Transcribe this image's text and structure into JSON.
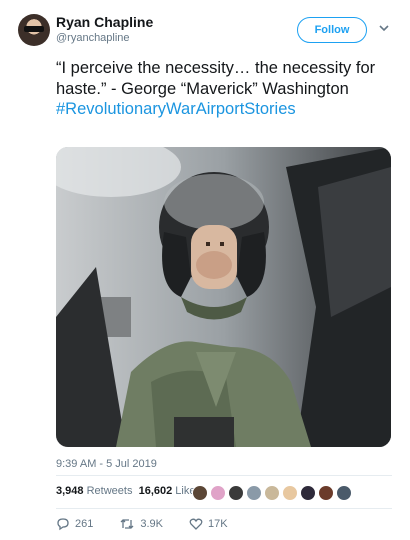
{
  "author": {
    "display_name": "Ryan Chapline",
    "handle": "@ryanchapline"
  },
  "follow_label": "Follow",
  "tweet": {
    "text": "“I perceive the necessity… the necessity for haste.”  - George “Maverick” Washington",
    "hashtag": "#RevolutionaryWarAirportStories"
  },
  "timestamp": "9:39 AM - 5 Jul 2019",
  "stats": {
    "retweets_count": "3,948",
    "retweets_label": "Retweets",
    "likes_count": "16,602",
    "likes_label": "Likes"
  },
  "likers": [
    "#5b4636",
    "#e0a3c8",
    "#3a3a3a",
    "#8a9aa8",
    "#c9b89a",
    "#e8c8a0",
    "#2e2a3a",
    "#6b3b2a",
    "#4a5a6a"
  ],
  "actions": {
    "replies": "261",
    "retweets": "3.9K",
    "likes": "17K"
  },
  "colors": {
    "accent": "#1da1f2",
    "hashtag": "#1b95e0",
    "secondary_text": "#657786"
  }
}
